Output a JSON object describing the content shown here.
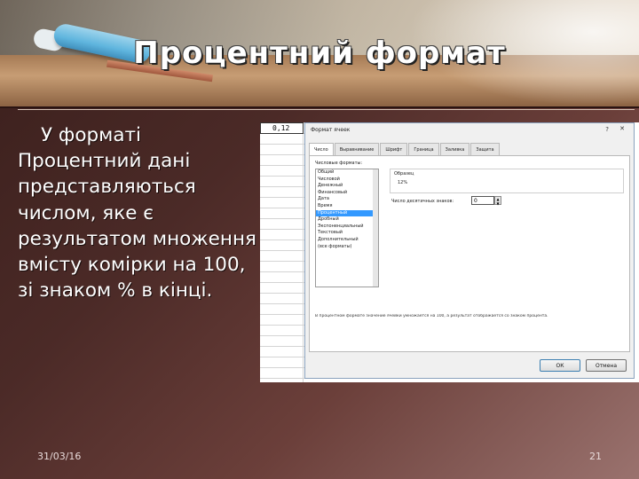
{
  "slide": {
    "title": "Процентний формат",
    "body": "У форматі Процентний дані представляються числом, яке є результатом множення вмісту комірки на 100, зі знаком % в кінці.",
    "date": "31/03/16",
    "page_number": "21"
  },
  "excel": {
    "cell_value": "0,12",
    "dialog": {
      "title": "Формат ячеек",
      "help_icon": "?",
      "close_icon": "✕",
      "tabs": [
        "Число",
        "Выравнивание",
        "Шрифт",
        "Граница",
        "Заливка",
        "Защита"
      ],
      "active_tab": 0,
      "formats_label": "Числовые форматы:",
      "formats": [
        "Общий",
        "Числовой",
        "Денежный",
        "Финансовый",
        "Дата",
        "Время",
        "Процентный",
        "Дробный",
        "Экспоненциальный",
        "Текстовый",
        "Дополнительный",
        "(все форматы)"
      ],
      "selected_format": 6,
      "sample_label": "Образец",
      "sample_value": "12%",
      "decimal_label": "Число десятичных знаков:",
      "decimal_value": "0",
      "description": "В процентном формате значение ячейки умножается на 100, а результат отображается со знаком процента.",
      "ok_label": "ОК",
      "cancel_label": "Отмена"
    }
  }
}
